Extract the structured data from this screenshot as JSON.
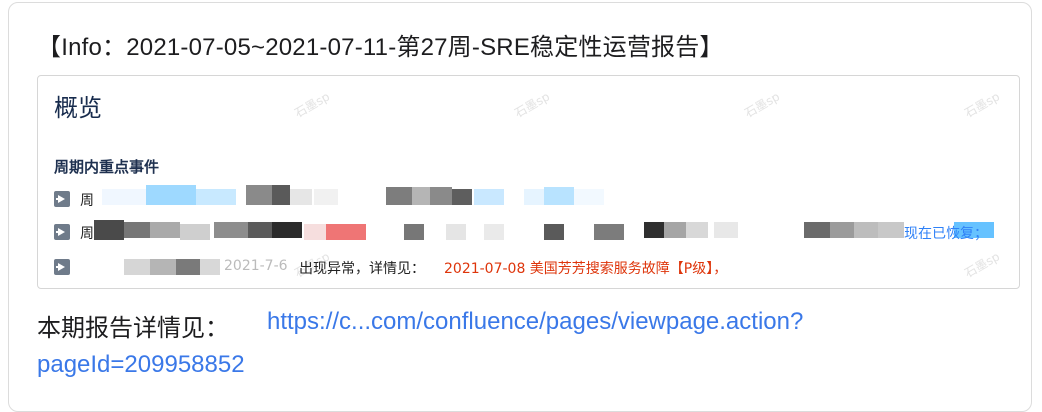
{
  "report": {
    "title": "【Info：2021-07-05~2021-07-11-第27周-SRE稳定性运营报告】",
    "overview_heading": "概览",
    "section_heading": "周期内重点事件",
    "rows": [
      {
        "prefix": "周",
        "tail": ""
      },
      {
        "prefix": "周期内",
        "tail": "现在已恢复；"
      },
      {
        "prefix": "",
        "mid": "2021-7-6",
        "status": "出现异常，详情见：",
        "incident": "2021-07-08 美国芳芳搜索服务故障【P级】，"
      }
    ],
    "watermark": "石墨sp",
    "detail_label": "本期报告详情见：",
    "link_line1": "https://c...com/confluence/pages/viewpage.action?",
    "link_line2": "pageId=209958852"
  },
  "colors": {
    "link": "#3a78e8",
    "incident_red": "#de350b",
    "heading_navy": "#172b4d"
  }
}
